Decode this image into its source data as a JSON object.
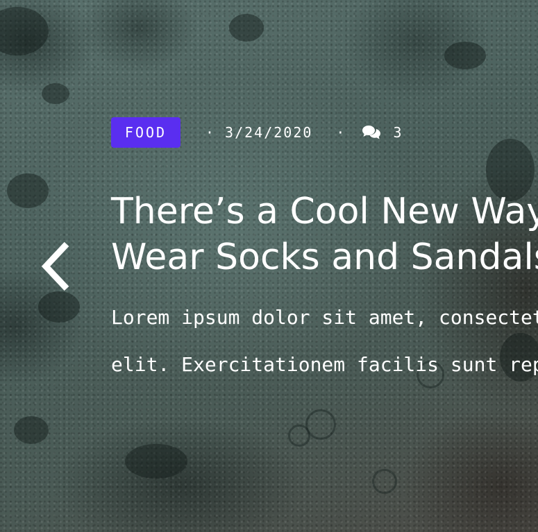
{
  "slide": {
    "category": "FOOD",
    "date": "3/24/2020",
    "comment_count": "3",
    "title_line1": "There’s a Cool New Way to",
    "title_line2": "Wear Socks and Sandals",
    "excerpt_line1": "Lorem ipsum dolor sit amet, consectetur adipisicing",
    "excerpt_line2": "elit. Exercitationem facilis sunt repellendus"
  },
  "icons": {
    "previous": "chevron-left-icon",
    "comments": "comments-icon"
  },
  "colors": {
    "badge": "#5a2ef0",
    "text": "#ffffff",
    "background": "#4f6461"
  }
}
